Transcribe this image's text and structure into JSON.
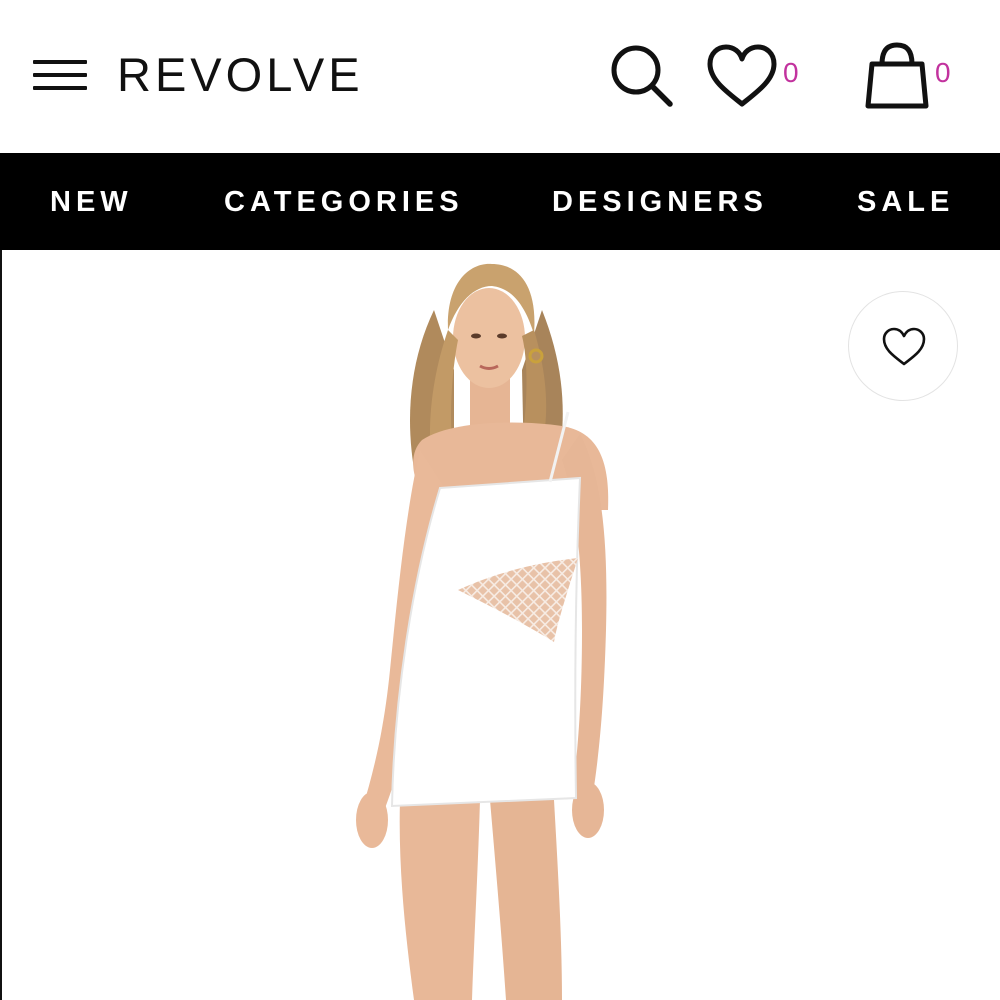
{
  "header": {
    "logo": "REVOLVE",
    "wishlist_count": "0",
    "bag_count": "0",
    "accent_color": "#c2329e"
  },
  "nav": {
    "items": [
      "NEW",
      "CATEGORIES",
      "DESIGNERS",
      "SALE"
    ]
  },
  "icons": {
    "menu": "hamburger-menu-icon",
    "search": "search-icon",
    "wishlist": "heart-icon",
    "bag": "shopping-bag-icon",
    "favorite": "heart-outline-icon"
  },
  "product": {
    "image_subject": "model-in-white-mini-dress"
  }
}
